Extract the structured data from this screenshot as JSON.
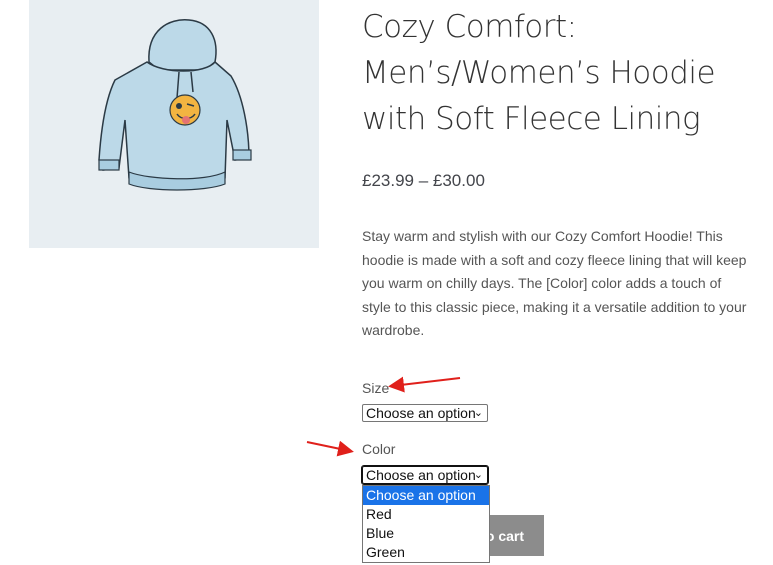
{
  "product": {
    "title": "Cozy Comfort: Men’s/Women’s Hoodie with Soft Fleece Lining",
    "price": "£23.99 – £30.00",
    "description": "Stay warm and stylish with our Cozy Comfort Hoodie! This hoodie is made with a soft and cozy fleece lining that will keep you warm on chilly days. The [Color] color adds a touch of style to this classic piece, making it a versatile addition to your wardrobe."
  },
  "variations": {
    "size": {
      "label": "Size",
      "selected": "Choose an option"
    },
    "color": {
      "label": "Color",
      "selected": "Choose an option",
      "options": [
        "Choose an option",
        "Red",
        "Blue",
        "Green"
      ]
    }
  },
  "add_to_cart": {
    "visible_label": "o cart"
  },
  "colors": {
    "image_bg": "#e8eef2",
    "hoodie": "#bcd9e8",
    "arrow": "#e0201b",
    "highlight": "#1a73e8"
  }
}
